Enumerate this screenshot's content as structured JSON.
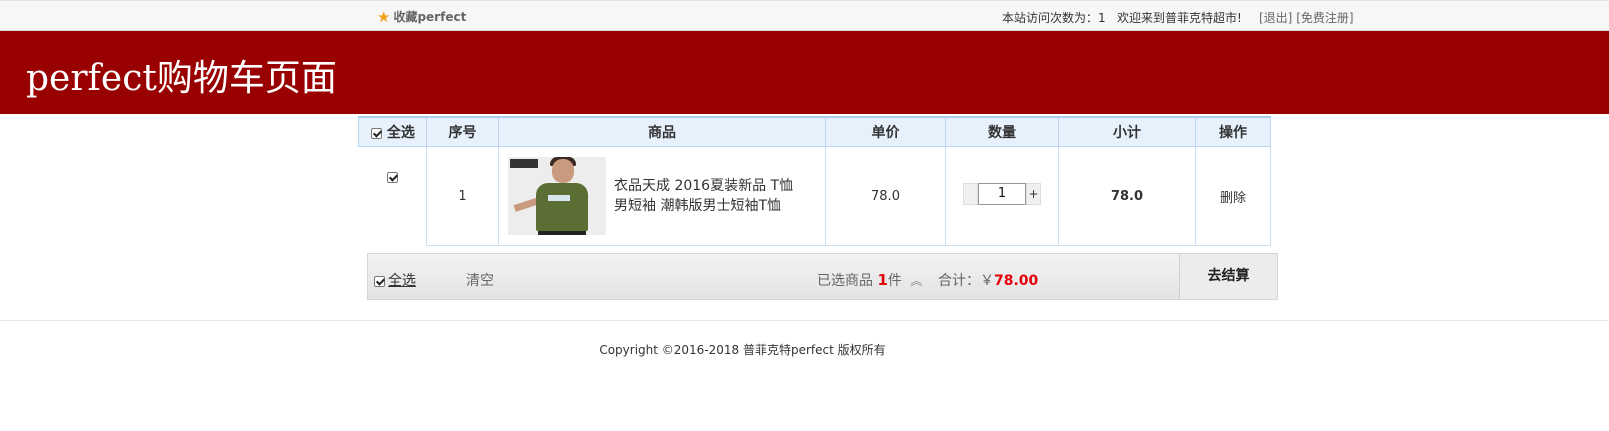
{
  "topbar": {
    "favorite_label": "收藏perfect",
    "visits_label": "本站访问次数为：",
    "visits_count": "1",
    "welcome_text": "欢迎来到普菲克特超市!",
    "logout_label": "[退出]",
    "register_label": "[免费注册]"
  },
  "banner": {
    "title": "perfect购物车页面"
  },
  "table": {
    "select_all_label": "全选",
    "headers": [
      "序号",
      "商品",
      "单价",
      "数量",
      "小计",
      "操作"
    ],
    "rows": [
      {
        "index": "1",
        "product_name": "衣品天成 2016夏装新品 T恤男短袖 潮韩版男士短袖T恤",
        "unit_price": "78.0",
        "quantity": "1",
        "subtotal": "78.0",
        "delete_label": "删除"
      }
    ]
  },
  "summary": {
    "select_all_label": "全选",
    "clear_label": "清空",
    "selected_prefix": "已选商品",
    "selected_count": "1",
    "selected_suffix": "件",
    "total_label": "合计：",
    "currency": "￥",
    "total_amount": "78.00",
    "checkout_label": "去结算"
  },
  "footer": {
    "copyright": "Copyright ©2016-2018 普菲克特perfect 版权所有"
  },
  "colors": {
    "banner": "#990000",
    "accent_red": "#e4000a",
    "header_bg": "#e6f1fc"
  }
}
